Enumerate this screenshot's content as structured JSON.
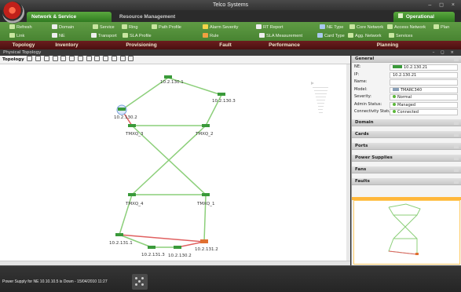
{
  "window": {
    "title": "Telco Systems",
    "controls": "– ◻ ×"
  },
  "tabs": {
    "nsm": "Network & Service Management",
    "rm": "Resource Management",
    "opnet": "Operational Network"
  },
  "ribbon": {
    "rows": [
      [
        "Refresh",
        "Domain",
        "Service",
        "Ring",
        "Path Profile",
        "Alarm Severity",
        "RT Report",
        "NE Type",
        "Core Network",
        "Access Network",
        "Plan"
      ],
      [
        "Link",
        "NE",
        "Transport",
        "SLA Profile",
        "Rule",
        "SLA Measurement",
        "Card Type",
        "Agg. Network",
        "Services"
      ]
    ],
    "groups": [
      "Topology",
      "Inventory",
      "Provisioning",
      "Fault",
      "Performance",
      "Planning"
    ]
  },
  "physical_topology": {
    "title": "Physical Topology",
    "controls": "– ◻ ×"
  },
  "topology_toolbar": {
    "label": "Topology"
  },
  "topology": {
    "nodes": {
      "n_tl": "10.2.130.2",
      "n_top": "10.2.130.1",
      "n_tr": "10.2.130.3",
      "tmxq3": "TMXQ_3",
      "tmxq2": "TMXQ_2",
      "tmxq4": "TMXQ_4",
      "tmxq1": "TMXQ_1",
      "n_bl": "10.2.131.1",
      "n_b1": "10.2.131.3",
      "n_b2": "10.2.130.2",
      "n_br": "10.2.131.2"
    }
  },
  "panel": {
    "general": {
      "title": "General",
      "props": [
        {
          "k": "NE:",
          "v": "10.2.130.21"
        },
        {
          "k": "IP:",
          "v": "10.2.130.21"
        },
        {
          "k": "Name:",
          "v": ""
        },
        {
          "k": "Model:",
          "v": "TMARC340"
        },
        {
          "k": "Severity:",
          "v": "Normal"
        },
        {
          "k": "Admin Status:",
          "v": "Managed"
        },
        {
          "k": "Connectivity Status:",
          "v": "Connected"
        }
      ]
    },
    "sections": [
      "Domain",
      "Cards",
      "Ports",
      "Power Supplies",
      "Fans",
      "Faults"
    ]
  },
  "status": {
    "text": "Power Supply for NE 10.10.10.5 is Down - 15/04/2010 11:27"
  }
}
